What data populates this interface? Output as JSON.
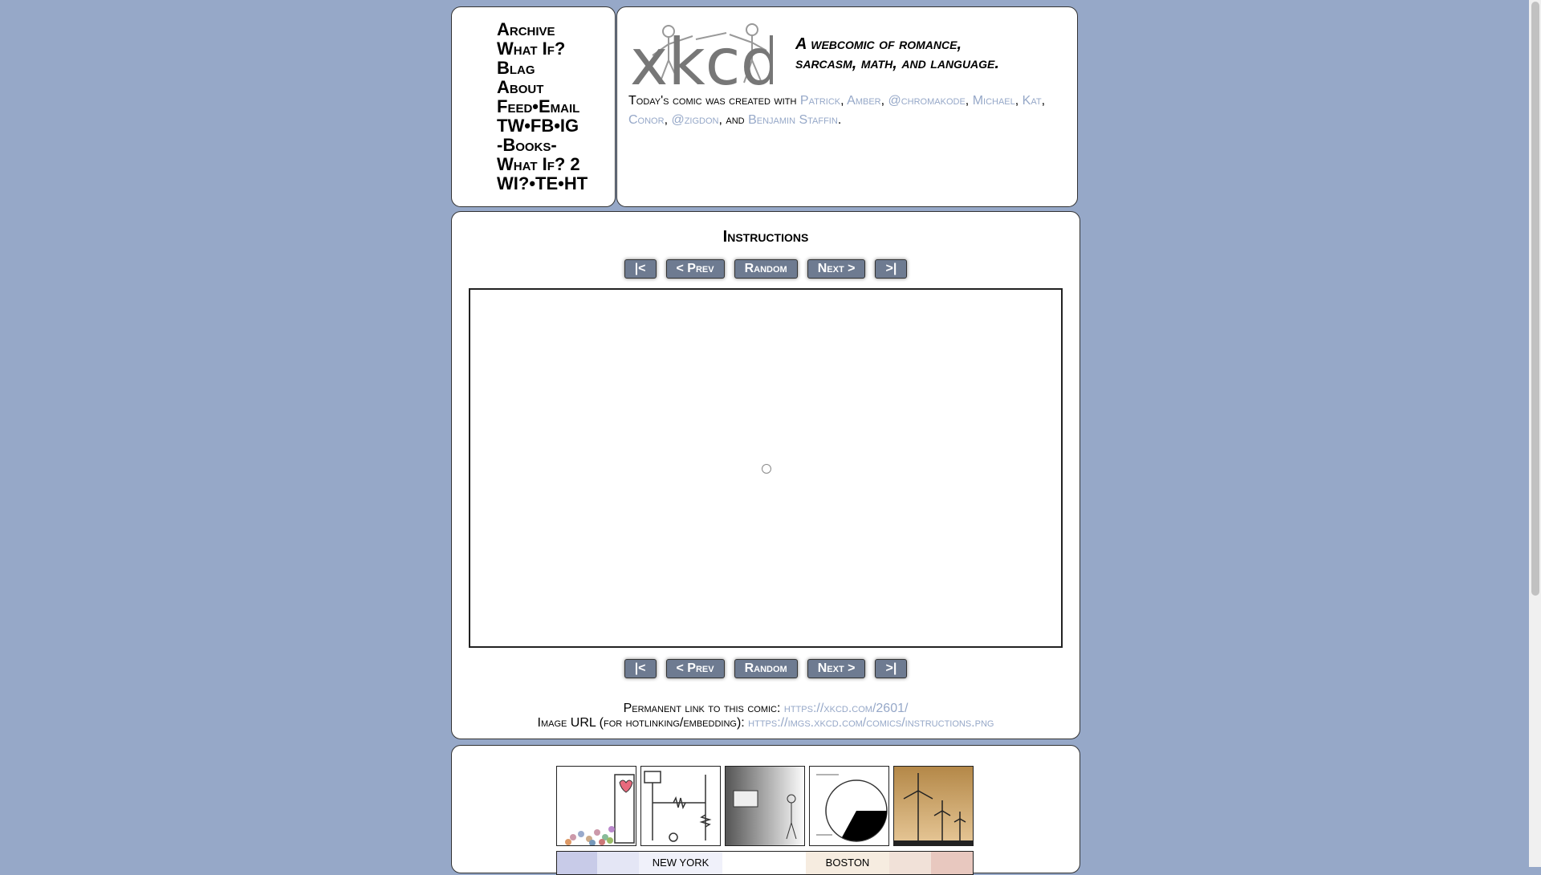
{
  "nav": [
    "Archive",
    "What If?",
    "Blag",
    "About",
    "Feed•Email",
    "TW•FB•IG",
    "-Books-",
    "What If? 2",
    "WI?•TE•HT"
  ],
  "logo": {
    "text": "xkcd"
  },
  "slogan": {
    "line1": "A webcomic of romance,",
    "line2": "sarcasm, math, and language."
  },
  "credits": {
    "prefix": "Today's comic was created with",
    "names": [
      "Patrick",
      "Amber",
      "@chromakode",
      "Michael",
      "Kat",
      "Conor",
      "@zigdon"
    ],
    "and": "and",
    "last": "Benjamin Staffin"
  },
  "comic": {
    "title": "Instructions"
  },
  "comic_nav": {
    "first": "|<",
    "prev": "< Prev",
    "random": "Random",
    "next": "Next >",
    "last": ">|"
  },
  "permalink": {
    "label": "Permanent link to this comic:",
    "url": "https://xkcd.com/2601/"
  },
  "image_url": {
    "label": "Image URL (for hotlinking/embedding):",
    "url": "https://imgs.xkcd.com/comics/instructions.png"
  },
  "thumb_map_labels": [
    "NEW YORK",
    "BOSTON"
  ],
  "colors": {
    "background": "#96A8C8",
    "link": "#96A8C8",
    "button": "#6E7B91"
  }
}
